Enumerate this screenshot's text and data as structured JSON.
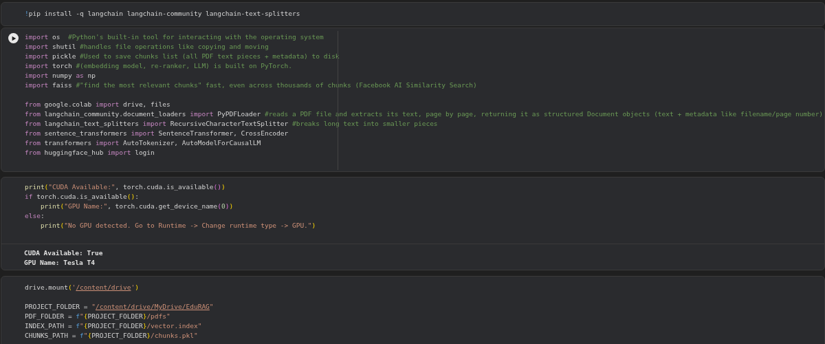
{
  "cells": [
    {
      "hovered": false,
      "lines": [
        {
          "tokens": [
            {
              "text": "!",
              "kind": "bang"
            },
            {
              "text": "pip install -q langchain langchain-community langchain-text-splitters",
              "kind": "plain"
            }
          ]
        }
      ]
    },
    {
      "hovered": true,
      "lines": [
        {
          "tokens": [
            {
              "text": "import",
              "kind": "kw"
            },
            {
              "text": " os  ",
              "kind": "plain"
            },
            {
              "text": "#Python's built-in tool for interacting with the operating system",
              "kind": "comment"
            }
          ]
        },
        {
          "tokens": [
            {
              "text": "import",
              "kind": "kw"
            },
            {
              "text": " shutil ",
              "kind": "plain"
            },
            {
              "text": "#handles file operations like copying and moving",
              "kind": "comment"
            }
          ]
        },
        {
          "tokens": [
            {
              "text": "import",
              "kind": "kw"
            },
            {
              "text": " pickle ",
              "kind": "plain"
            },
            {
              "text": "#Used to save chunks list (all PDF text pieces + metadata) to disk",
              "kind": "comment"
            }
          ]
        },
        {
          "tokens": [
            {
              "text": "import",
              "kind": "kw"
            },
            {
              "text": " torch ",
              "kind": "plain"
            },
            {
              "text": "#(embedding model, re-ranker, LLM) is built on PyTorch.",
              "kind": "comment"
            }
          ]
        },
        {
          "tokens": [
            {
              "text": "import",
              "kind": "kw"
            },
            {
              "text": " numpy ",
              "kind": "plain"
            },
            {
              "text": "as",
              "kind": "kw"
            },
            {
              "text": " np",
              "kind": "plain"
            }
          ]
        },
        {
          "tokens": [
            {
              "text": "import",
              "kind": "kw"
            },
            {
              "text": " faiss ",
              "kind": "plain"
            },
            {
              "text": "#\"find the most relevant chunks\" fast, even across thousands of chunks (Facebook AI Similarity Search)",
              "kind": "comment"
            }
          ]
        },
        {
          "kind": "blank"
        },
        {
          "tokens": [
            {
              "text": "from",
              "kind": "kw"
            },
            {
              "text": " google.colab ",
              "kind": "plain"
            },
            {
              "text": "import",
              "kind": "kw"
            },
            {
              "text": " drive, files",
              "kind": "plain"
            }
          ]
        },
        {
          "tokens": [
            {
              "text": "from",
              "kind": "kw"
            },
            {
              "text": " langchain_community.document_loaders ",
              "kind": "plain"
            },
            {
              "text": "import",
              "kind": "kw"
            },
            {
              "text": " PyPDFLoader ",
              "kind": "plain"
            },
            {
              "text": "#reads a PDF file and extracts its text, page by page, returning it as structured Document objects (text + metadata like filename/page number)",
              "kind": "comment"
            }
          ]
        },
        {
          "tokens": [
            {
              "text": "from",
              "kind": "kw"
            },
            {
              "text": " langchain_text_splitters ",
              "kind": "plain"
            },
            {
              "text": "import",
              "kind": "kw"
            },
            {
              "text": " RecursiveCharacterTextSplitter ",
              "kind": "plain"
            },
            {
              "text": "#breaks long text into smaller pieces",
              "kind": "comment"
            }
          ]
        },
        {
          "tokens": [
            {
              "text": "from",
              "kind": "kw"
            },
            {
              "text": " sentence_transformers ",
              "kind": "plain"
            },
            {
              "text": "import",
              "kind": "kw"
            },
            {
              "text": " SentenceTransformer, CrossEncoder",
              "kind": "plain"
            }
          ]
        },
        {
          "tokens": [
            {
              "text": "from",
              "kind": "kw"
            },
            {
              "text": " transformers ",
              "kind": "plain"
            },
            {
              "text": "import",
              "kind": "kw"
            },
            {
              "text": " AutoTokenizer, AutoModelForCausalLM",
              "kind": "plain"
            }
          ]
        },
        {
          "tokens": [
            {
              "text": "from",
              "kind": "kw"
            },
            {
              "text": " huggingface_hub ",
              "kind": "plain"
            },
            {
              "text": "import",
              "kind": "kw"
            },
            {
              "text": " login",
              "kind": "plain"
            }
          ]
        }
      ]
    },
    {
      "hovered": false,
      "lines": [
        {
          "tokens": [
            {
              "text": "print",
              "kind": "fn"
            },
            {
              "text": "(",
              "kind": "bracket"
            },
            {
              "text": "\"CUDA Available:\"",
              "kind": "str"
            },
            {
              "text": ", torch.cuda.is_available",
              "kind": "plain"
            },
            {
              "text": "()",
              "kind": "bracket2"
            },
            {
              "text": ")",
              "kind": "bracket"
            }
          ]
        },
        {
          "tokens": [
            {
              "text": "if",
              "kind": "kw"
            },
            {
              "text": " torch.cuda.is_available",
              "kind": "plain"
            },
            {
              "text": "()",
              "kind": "bracket"
            },
            {
              "text": ":",
              "kind": "plain"
            }
          ]
        },
        {
          "indent": true,
          "tokens": [
            {
              "text": "print",
              "kind": "fn"
            },
            {
              "text": "(",
              "kind": "bracket"
            },
            {
              "text": "\"GPU Name:\"",
              "kind": "str"
            },
            {
              "text": ", torch.cuda.get_device_name",
              "kind": "plain"
            },
            {
              "text": "(",
              "kind": "bracket2"
            },
            {
              "text": "0",
              "kind": "num"
            },
            {
              "text": ")",
              "kind": "bracket2"
            },
            {
              "text": ")",
              "kind": "bracket"
            }
          ]
        },
        {
          "tokens": [
            {
              "text": "else",
              "kind": "kw"
            },
            {
              "text": ":",
              "kind": "plain"
            }
          ]
        },
        {
          "indent": true,
          "tokens": [
            {
              "text": "print",
              "kind": "fn"
            },
            {
              "text": "(",
              "kind": "bracket"
            },
            {
              "text": "\"No GPU detected. Go to Runtime -> Change runtime type -> GPU.\"",
              "kind": "str"
            },
            {
              "text": ")",
              "kind": "bracket"
            }
          ]
        }
      ],
      "output": [
        "CUDA Available: True",
        "GPU Name: Tesla T4"
      ]
    },
    {
      "hovered": false,
      "lines": [
        {
          "tokens": [
            {
              "text": "drive.mount",
              "kind": "plain"
            },
            {
              "text": "(",
              "kind": "bracket"
            },
            {
              "text": "'",
              "kind": "str"
            },
            {
              "text": "/content/drive",
              "kind": "link"
            },
            {
              "text": "'",
              "kind": "str"
            },
            {
              "text": ")",
              "kind": "bracket"
            }
          ]
        },
        {
          "kind": "blank"
        },
        {
          "tokens": [
            {
              "text": "PROJECT_FOLDER = ",
              "kind": "plain"
            },
            {
              "text": "\"",
              "kind": "str"
            },
            {
              "text": "/content/drive/MyDrive/EduRAG",
              "kind": "link"
            },
            {
              "text": "\"",
              "kind": "str"
            }
          ]
        },
        {
          "tokens": [
            {
              "text": "PDF_FOLDER = ",
              "kind": "plain"
            },
            {
              "text": "f",
              "kind": "prefix"
            },
            {
              "text": "\"",
              "kind": "str"
            },
            {
              "text": "{",
              "kind": "bracket"
            },
            {
              "text": "PROJECT_FOLDER",
              "kind": "plain"
            },
            {
              "text": "}",
              "kind": "bracket"
            },
            {
              "text": "/pdfs\"",
              "kind": "str"
            }
          ]
        },
        {
          "tokens": [
            {
              "text": "INDEX_PATH = ",
              "kind": "plain"
            },
            {
              "text": "f",
              "kind": "prefix"
            },
            {
              "text": "\"",
              "kind": "str"
            },
            {
              "text": "{",
              "kind": "bracket"
            },
            {
              "text": "PROJECT_FOLDER",
              "kind": "plain"
            },
            {
              "text": "}",
              "kind": "bracket"
            },
            {
              "text": "/vector.index\"",
              "kind": "str"
            }
          ]
        },
        {
          "tokens": [
            {
              "text": "CHUNKS_PATH = ",
              "kind": "plain"
            },
            {
              "text": "f",
              "kind": "prefix"
            },
            {
              "text": "\"",
              "kind": "str"
            },
            {
              "text": "{",
              "kind": "bracket"
            },
            {
              "text": "PROJECT_FOLDER",
              "kind": "plain"
            },
            {
              "text": "}",
              "kind": "bracket"
            },
            {
              "text": "/chunks.pkl\"",
              "kind": "str"
            }
          ]
        }
      ]
    }
  ]
}
